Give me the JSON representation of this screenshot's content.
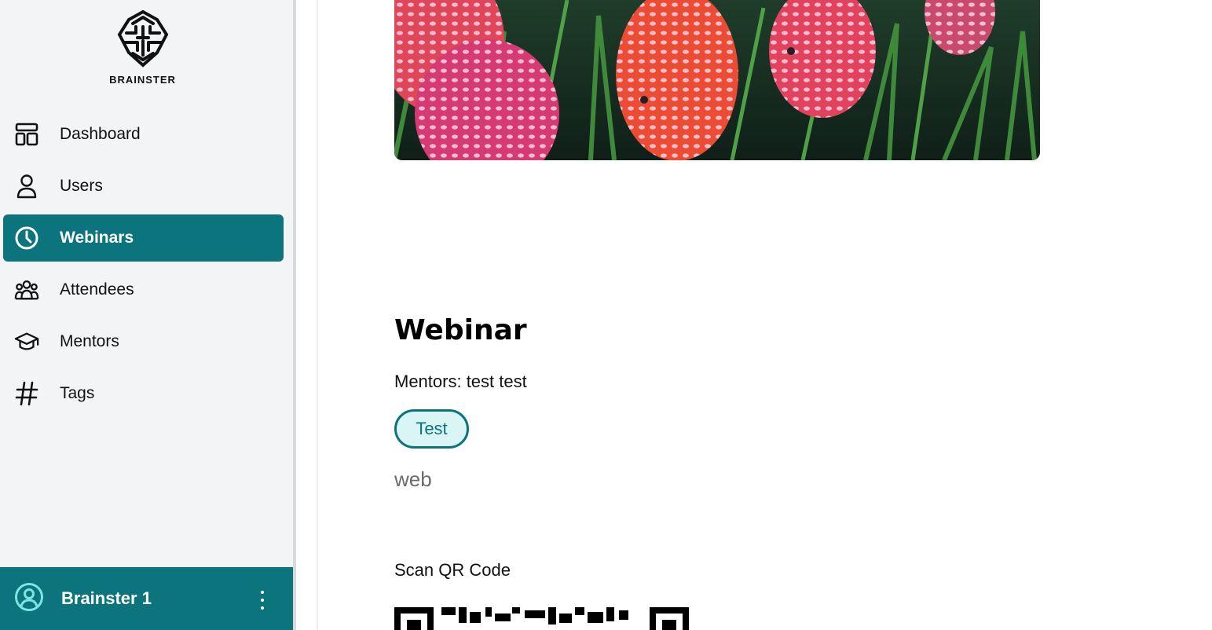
{
  "brand": {
    "name": "BRAINSTER",
    "logo_icon": "brain-maze-icon"
  },
  "sidebar": {
    "items": [
      {
        "label": "Dashboard",
        "icon": "dashboard-icon"
      },
      {
        "label": "Users",
        "icon": "user-icon"
      },
      {
        "label": "Webinars",
        "icon": "clock-icon",
        "active": true
      },
      {
        "label": "Attendees",
        "icon": "group-icon"
      },
      {
        "label": "Mentors",
        "icon": "graduation-cap-icon"
      },
      {
        "label": "Tags",
        "icon": "hash-icon"
      }
    ]
  },
  "user": {
    "name": "Brainster 1",
    "avatar_icon": "user-circle-icon",
    "menu_icon": "kebab-menu-icon"
  },
  "webinar": {
    "title": "Webinar",
    "mentors": "Mentors: test test",
    "tag": "Test",
    "description": "web",
    "qr_label": "Scan QR Code"
  },
  "colors": {
    "accent": "#0c747c",
    "tag_bg": "#d9f5f5",
    "sidebar_bg": "#f3f4f6",
    "muted_text": "#6b6b6b"
  }
}
